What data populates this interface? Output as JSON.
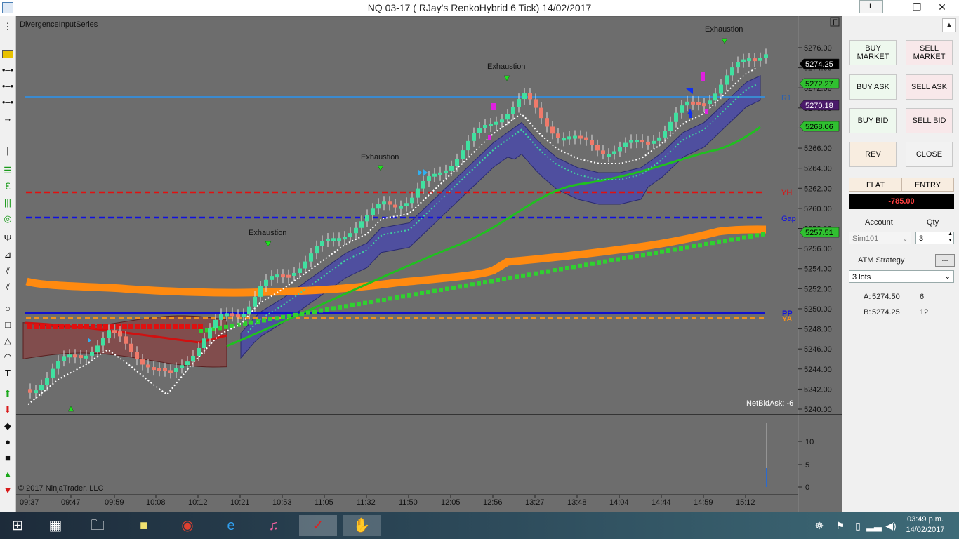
{
  "window": {
    "title": "NQ 03-17 ( RJay's RenkoHybrid  6 Tick)  14/02/2017",
    "link_button": "L",
    "minimize": "—",
    "restore": "❐",
    "close": "✕"
  },
  "chart": {
    "indicator_name": "DivergenceInputSeries",
    "copyright": "© 2017 NinjaTrader, LLC",
    "netbidask": "NetBidAsk: -6",
    "collapse_button": "F",
    "exhaustion_labels": [
      "Exhaustion",
      "Exhaustion",
      "Exhaustion",
      "Exhaustion"
    ],
    "level_labels": {
      "r1": "R1",
      "yh": "YH",
      "gap": "Gap",
      "pp": "PP",
      "ya": "YA"
    },
    "price_ticks": [
      "5276.00",
      "5274.00",
      "5272.00",
      "5270.00",
      "5268.00",
      "5266.00",
      "5264.00",
      "5262.00",
      "5260.00",
      "5258.00",
      "5256.00",
      "5254.00",
      "5252.00",
      "5250.00",
      "5248.00",
      "5246.00",
      "5244.00",
      "5242.00",
      "5240.00"
    ],
    "price_markers": [
      {
        "text": "5274.25",
        "color": "#000000",
        "fg": "#ffffff"
      },
      {
        "text": "5272.27",
        "color": "#30c030",
        "fg": "#000000"
      },
      {
        "text": "5270.18",
        "color": "#4a1a6a",
        "fg": "#ffffff"
      },
      {
        "text": "5268.06",
        "color": "#30c030",
        "fg": "#000000"
      },
      {
        "text": "5257.51",
        "color": "#30c030",
        "fg": "#000000"
      }
    ],
    "volume_ticks": [
      "10",
      "5",
      "0"
    ],
    "time_ticks": [
      "09:37",
      "09:47",
      "09:59",
      "10:08",
      "10:12",
      "10:21",
      "10:53",
      "11:05",
      "11:32",
      "11:50",
      "12:05",
      "12:56",
      "13:27",
      "13:48",
      "14:04",
      "14:44",
      "14:59",
      "15:12"
    ]
  },
  "order_panel": {
    "buy_market": "BUY MARKET",
    "sell_market": "SELL MARKET",
    "buy_ask": "BUY ASK",
    "sell_ask": "SELL ASK",
    "buy_bid": "BUY BID",
    "sell_bid": "SELL BID",
    "rev": "REV",
    "close": "CLOSE",
    "flat": "FLAT",
    "entry": "ENTRY",
    "pnl": "-785.00",
    "account_label": "Account",
    "qty_label": "Qty",
    "account_value": "Sim101",
    "qty_value": "3",
    "atm_label": "ATM Strategy",
    "atm_button": "...",
    "atm_value": "3 lots",
    "ask_label": "A:",
    "ask_price": "5274.50",
    "ask_size": "6",
    "bid_label": "B:",
    "bid_price": "5274.25",
    "bid_size": "12"
  },
  "taskbar": {
    "time": "03:49 p.m.",
    "date": "14/02/2017"
  }
}
